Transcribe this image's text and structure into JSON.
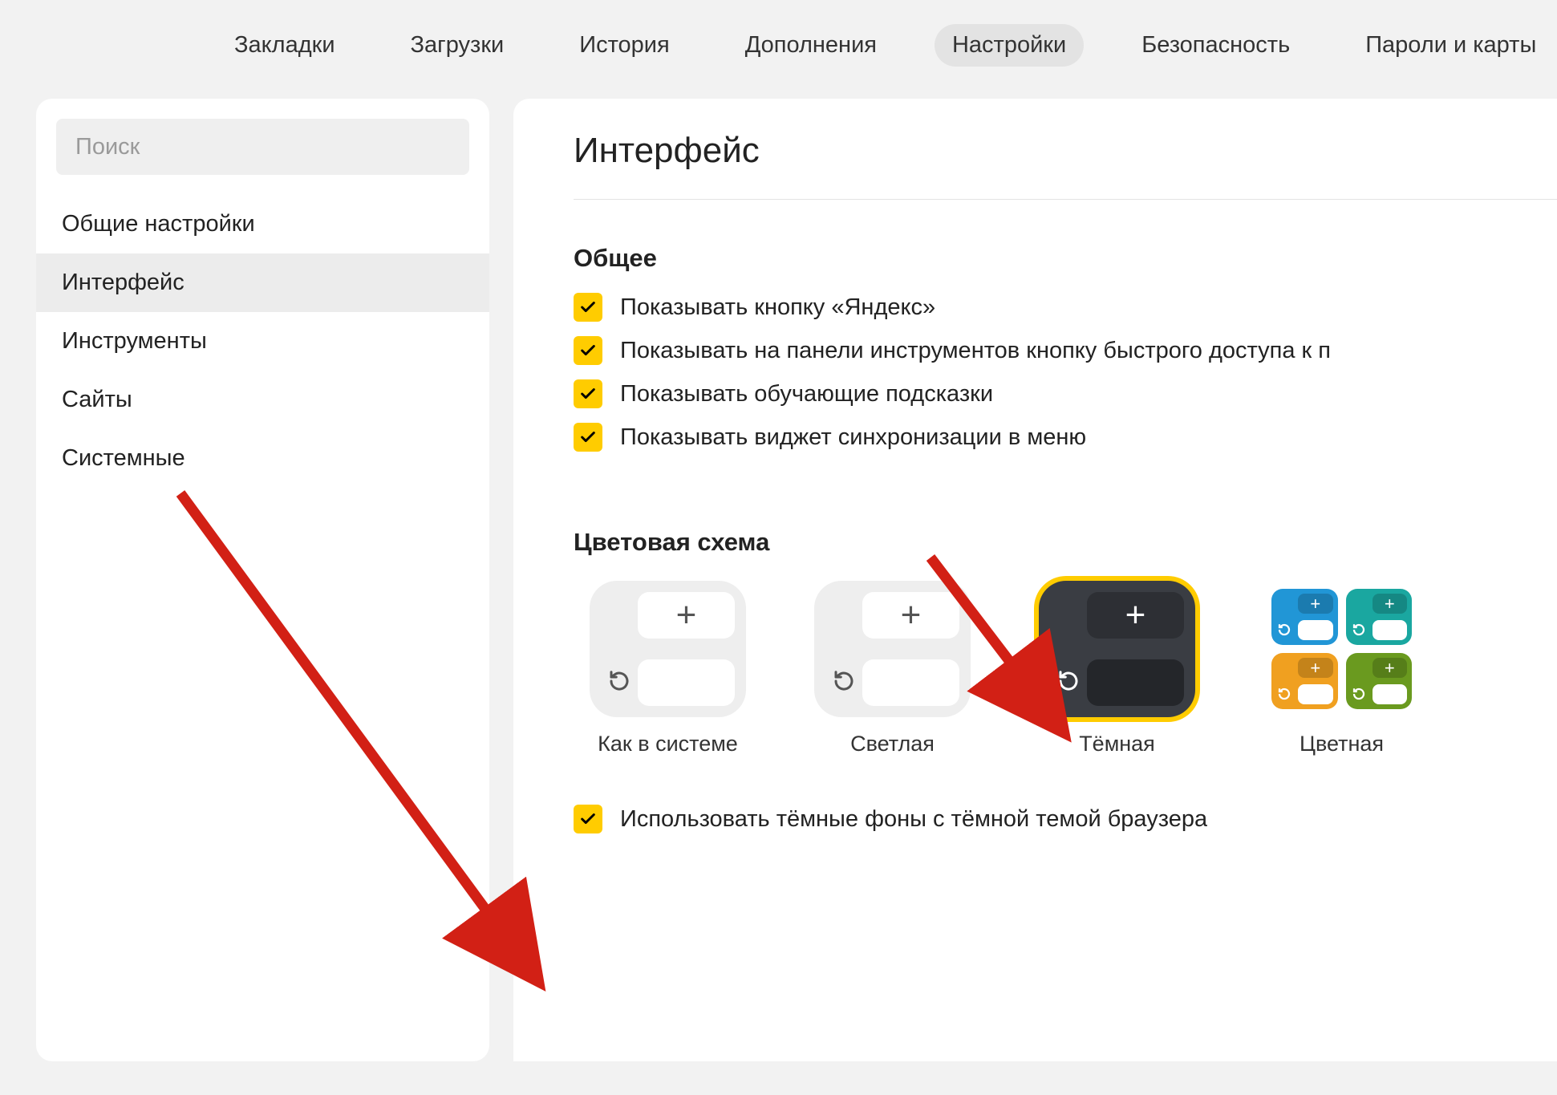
{
  "topnav": {
    "items": [
      {
        "label": "Закладки"
      },
      {
        "label": "Загрузки"
      },
      {
        "label": "История"
      },
      {
        "label": "Дополнения"
      },
      {
        "label": "Настройки",
        "active": true
      },
      {
        "label": "Безопасность"
      },
      {
        "label": "Пароли и карты"
      }
    ]
  },
  "sidebar": {
    "search_placeholder": "Поиск",
    "items": [
      {
        "label": "Общие настройки"
      },
      {
        "label": "Интерфейс",
        "active": true
      },
      {
        "label": "Инструменты"
      },
      {
        "label": "Сайты"
      },
      {
        "label": "Системные"
      }
    ]
  },
  "main": {
    "page_title": "Интерфейс",
    "section_general": "Общее",
    "checks": [
      "Показывать кнопку «Яндекс»",
      "Показывать на панели инструментов кнопку быстрого доступа к п",
      "Показывать обучающие подсказки",
      "Показывать виджет синхронизации в меню"
    ],
    "section_scheme": "Цветовая схема",
    "themes": [
      {
        "label": "Как в системе"
      },
      {
        "label": "Светлая"
      },
      {
        "label": "Тёмная",
        "selected": true
      },
      {
        "label": "Цветная"
      }
    ],
    "darkbg_check": "Использовать тёмные фоны с тёмной темой браузера"
  },
  "colors": {
    "accent": "#ffcc00",
    "arrow": "#d22015"
  }
}
